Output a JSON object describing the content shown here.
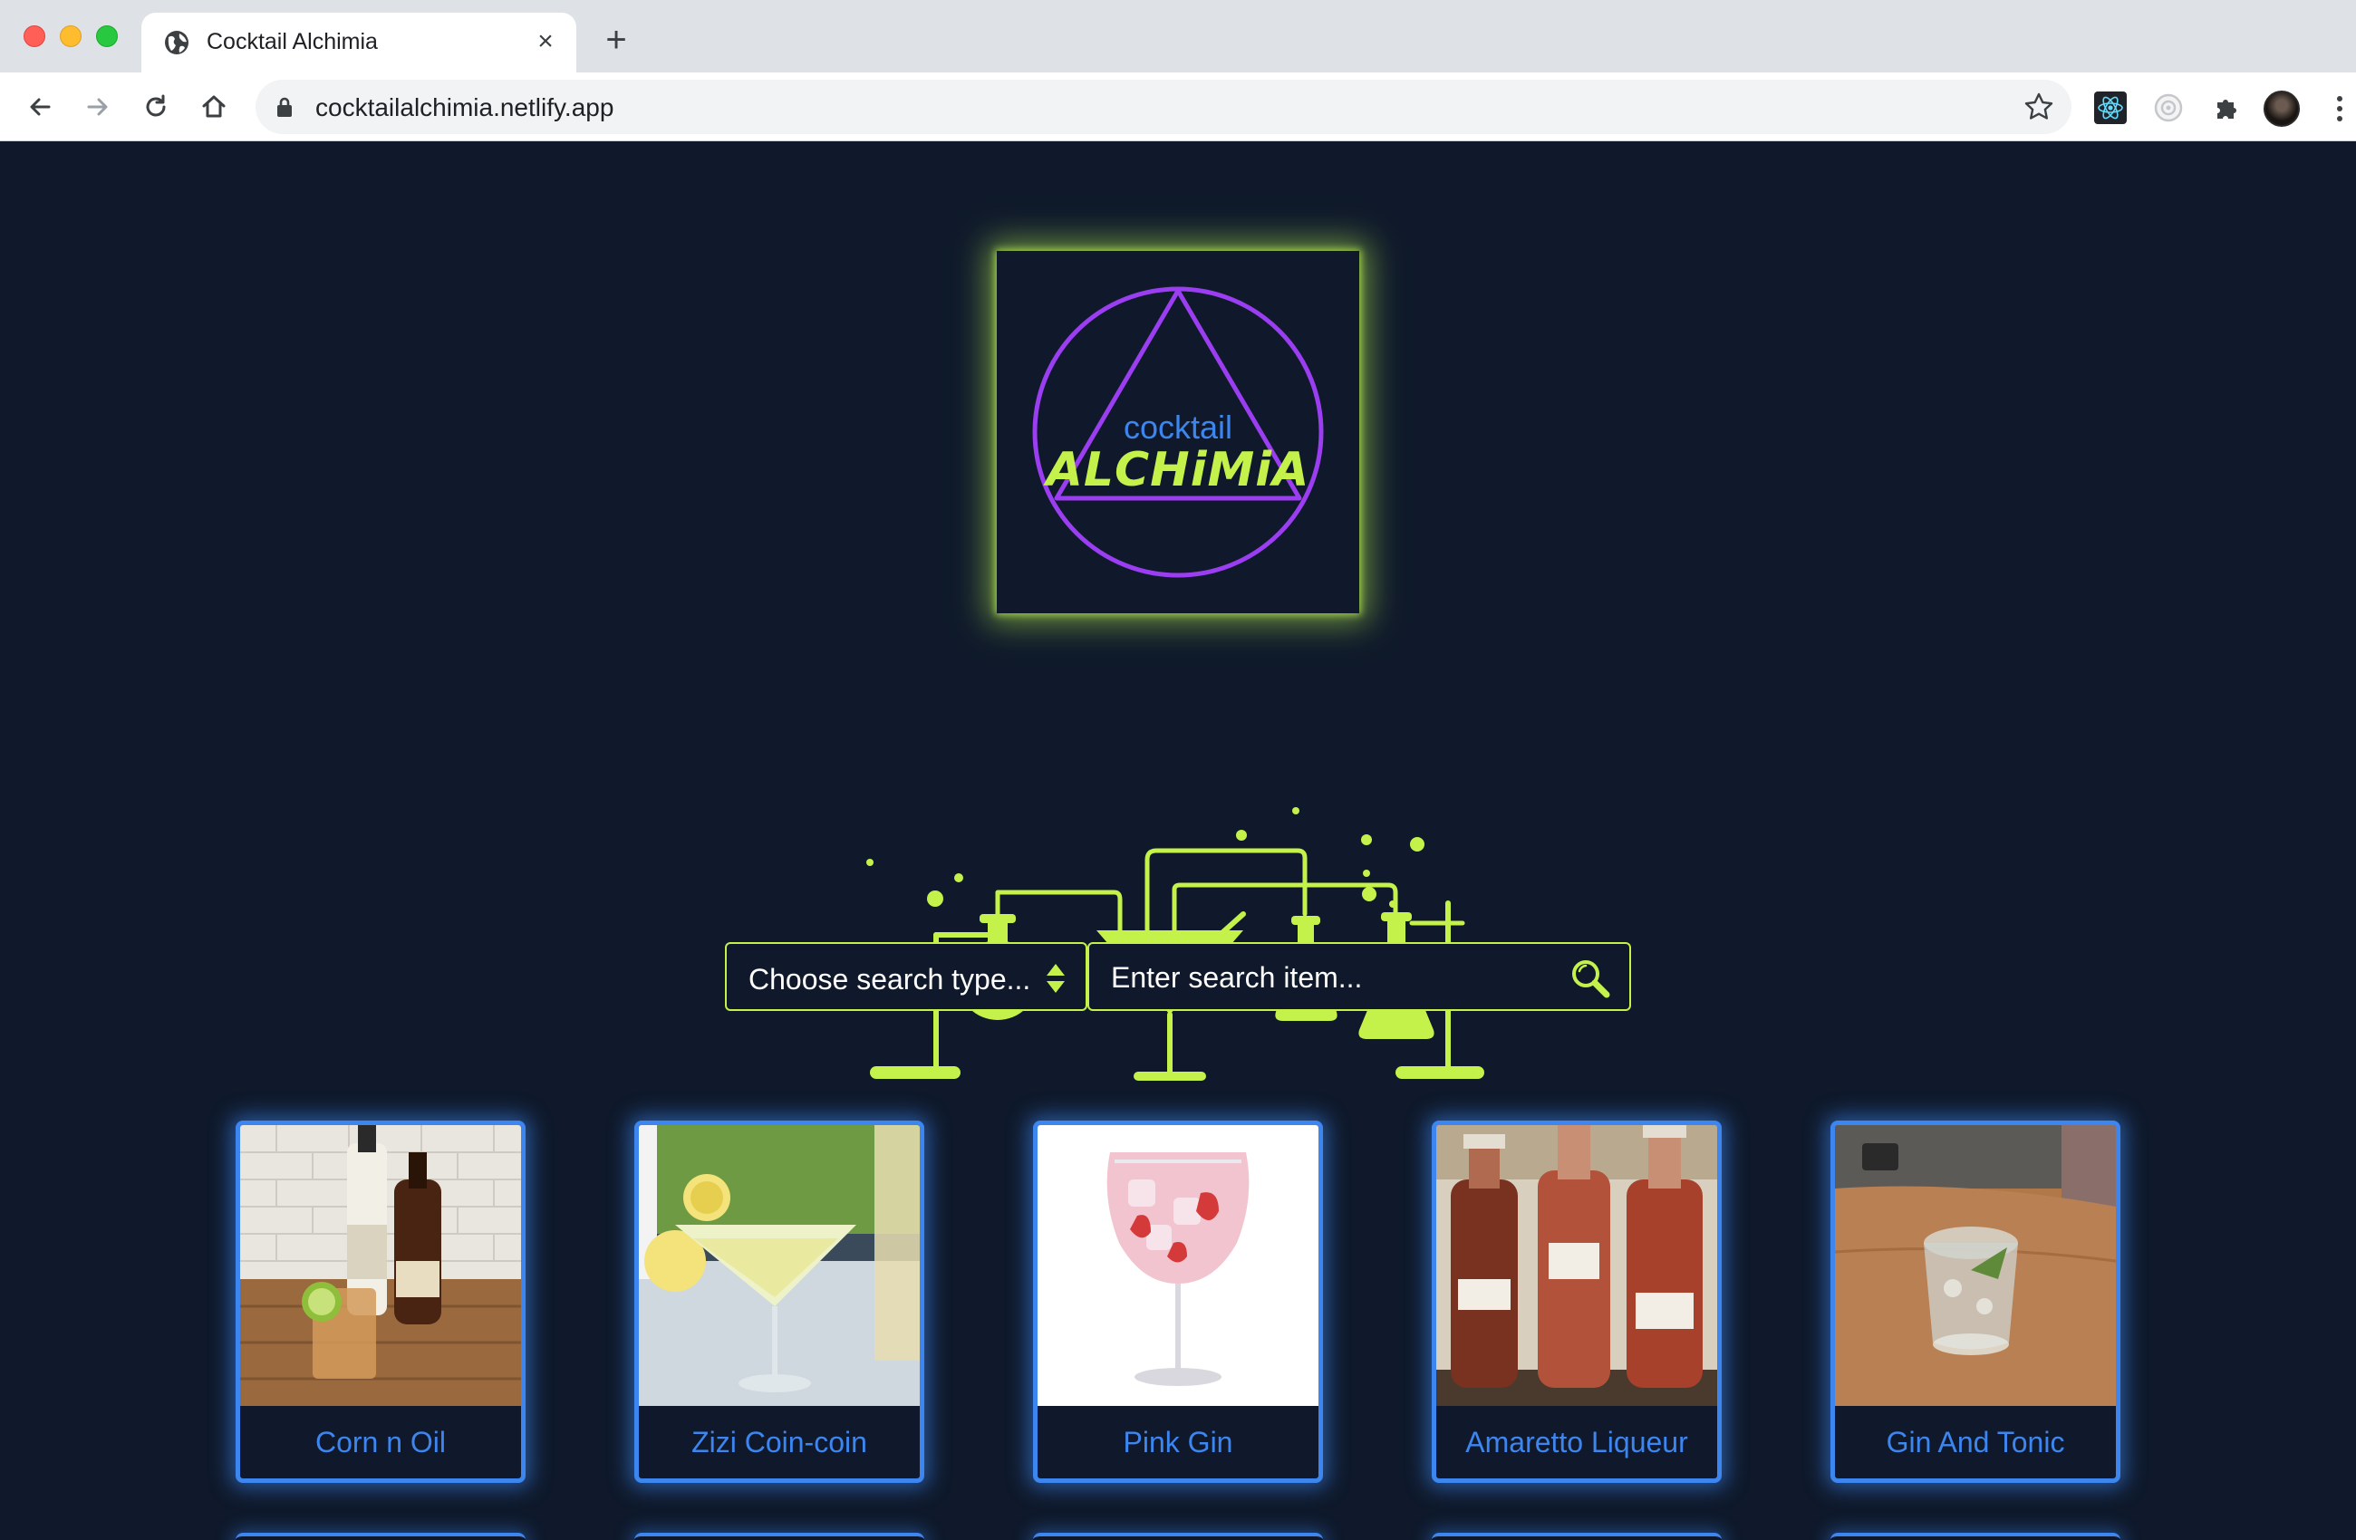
{
  "browser": {
    "tab_title": "Cocktail Alchimia",
    "tab_close_glyph": "×",
    "new_tab_glyph": "+",
    "url": "cocktailalchimia.netlify.app"
  },
  "logo": {
    "top_word": "cocktail",
    "bottom_word": "ALCHiMiA",
    "colors": {
      "ring": "#9b3df0",
      "top_word": "#3d86f0",
      "bottom_word": "#c5f24a",
      "glow": "#c5f24a"
    }
  },
  "search": {
    "type_label": "Choose search type...",
    "input_placeholder": "Enter search item...",
    "accent": "#c5f24a"
  },
  "cocktails": [
    {
      "name": "Corn n Oil"
    },
    {
      "name": "Zizi Coin-coin"
    },
    {
      "name": "Pink Gin"
    },
    {
      "name": "Amaretto Liqueur"
    },
    {
      "name": "Gin And Tonic"
    }
  ],
  "theme": {
    "background": "#0f192b",
    "card_border": "#3d86f0"
  }
}
